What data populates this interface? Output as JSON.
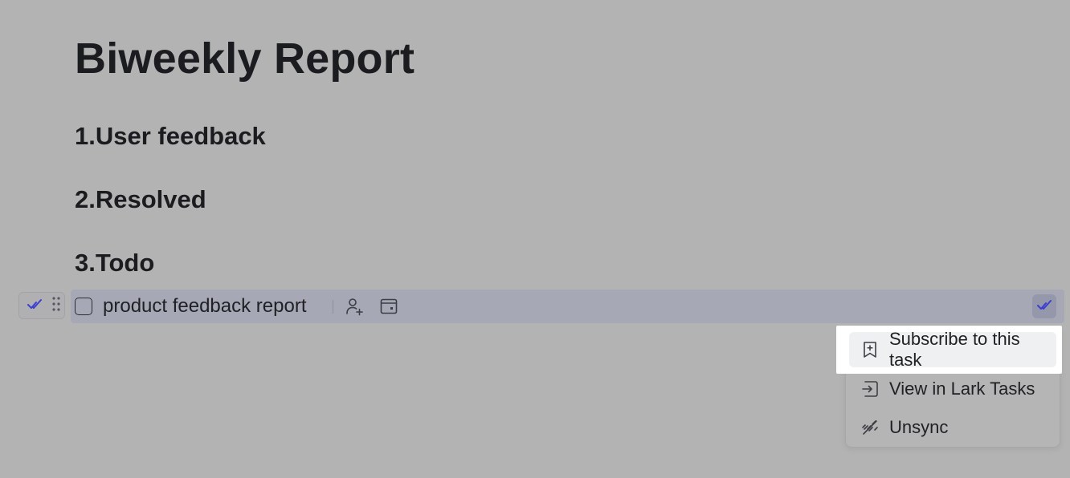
{
  "document": {
    "title": "Biweekly Report",
    "headings": [
      "1.User feedback",
      "2.Resolved",
      "3.Todo"
    ]
  },
  "task": {
    "title": "product feedback report",
    "checked": false,
    "icons": {
      "handle_task": "task-check-icon",
      "drag": "drag-handle-icon",
      "assign": "add-assignee-icon",
      "due_date": "due-date-icon",
      "badge": "task-check-icon"
    }
  },
  "context_menu": {
    "items": [
      {
        "label": "Subscribe to this task",
        "icon": "bookmark-plus-icon",
        "highlighted": true
      },
      {
        "label": "View in Lark Tasks",
        "icon": "open-external-icon",
        "highlighted": false
      },
      {
        "label": "Unsync",
        "icon": "unlink-icon",
        "highlighted": false
      }
    ]
  },
  "colors": {
    "overlay_background": "#b3b3b3",
    "task_row_highlight": "#a6a8b5",
    "accent_icon": "#3b3fd0",
    "menu_highlight": "#ffffff"
  }
}
